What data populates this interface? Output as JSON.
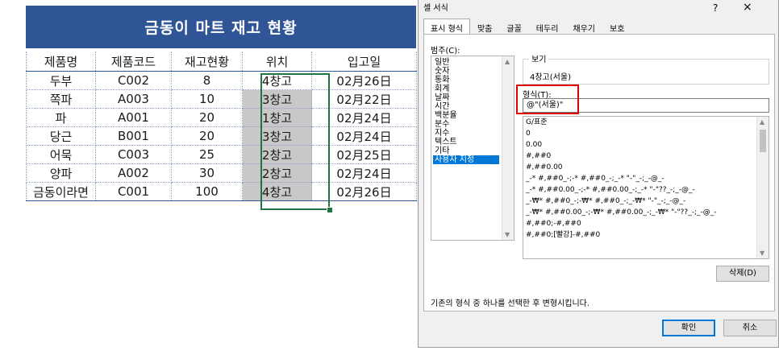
{
  "sheet": {
    "title": "금동이 마트 재고 현황",
    "headers": [
      "제품명",
      "제품코드",
      "재고현황",
      "위치",
      "입고일"
    ],
    "rows": [
      [
        "두부",
        "C002",
        "8",
        "4창고",
        "02月26日"
      ],
      [
        "쪽파",
        "A003",
        "10",
        "3창고",
        "02月22日"
      ],
      [
        "파",
        "A001",
        "20",
        "1창고",
        "02月24日"
      ],
      [
        "당근",
        "B001",
        "20",
        "3창고",
        "02月24日"
      ],
      [
        "어묵",
        "C003",
        "25",
        "2창고",
        "02月25日"
      ],
      [
        "양파",
        "A002",
        "30",
        "2창고",
        "02月24日"
      ],
      [
        "금동이라면",
        "C001",
        "100",
        "4창고",
        "02月26日"
      ]
    ]
  },
  "dialog": {
    "title": "셀 서식",
    "help": "?",
    "close": "×",
    "tabs": [
      "표시 형식",
      "맞춤",
      "글꼴",
      "테두리",
      "채우기",
      "보호"
    ],
    "category_label": "범주(C):",
    "categories": [
      "일반",
      "숫자",
      "통화",
      "회계",
      "날짜",
      "시간",
      "백분율",
      "분수",
      "지수",
      "텍스트",
      "기타",
      "사용자 지정"
    ],
    "selected_category": "사용자 지정",
    "sample_label": "보기",
    "sample_value": "4창고(서울)",
    "format_label": "형식(T):",
    "format_value": "@\"(서울)\"",
    "format_list": [
      "G/표준",
      "0",
      "0.00",
      "#,##0",
      "#,##0.00",
      "_-* #,##0_-;-* #,##0_-;_-* \"-\"_-;_-@_-",
      "_-* #,##0.00_-;-* #,##0.00_-;_-* \"-\"??_-;_-@_-",
      "_-₩* #,##0_-;-₩* #,##0_-;_-₩* \"-\"_-;_-@_-",
      "_-₩* #,##0.00_-;-₩* #,##0.00_-;_-₩* \"-\"??_-;_-@_-",
      "#,##0;-#,##0",
      "#,##0;[빨강]-#,##0"
    ],
    "delete_label": "삭제(D)",
    "hint": "기존의 형식 중 하나를 선택한 후 변형시킵니다.",
    "ok_label": "확인",
    "cancel_label": "취소"
  },
  "colors": {
    "title_bar": "#2f5597",
    "selection": "#217346",
    "highlight_box": "#e00000",
    "list_selected": "#0078d7",
    "location_fill": "#c8c8c8"
  }
}
